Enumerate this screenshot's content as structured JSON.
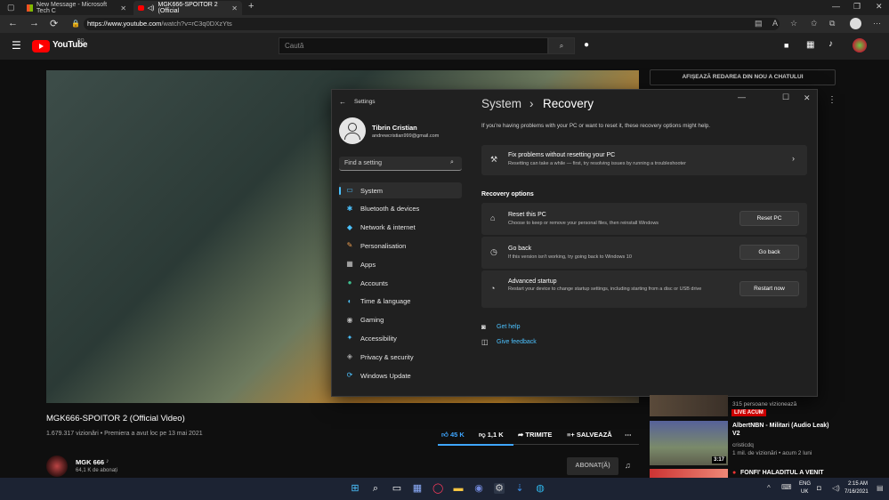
{
  "browser": {
    "tabs": [
      {
        "label": "New Message - Microsoft Tech C"
      },
      {
        "label": "MGK666-SPOITOR 2 (Official"
      }
    ],
    "url_host": "https://www.youtube.com",
    "url_path": "/watch?v=rC3q0DXzYts"
  },
  "youtube": {
    "logo_text": "YouTube",
    "region": "RO",
    "search_placeholder": "Caută",
    "chat_button": "AFIȘEAZĂ REDAREA DIN NOU A CHATULUI",
    "video": {
      "title": "MGK666-SPOITOR 2 (Official Video)",
      "meta": "1.679.317 vizionări • Premiera a avut loc pe 13 mai 2021",
      "likes": "45 K",
      "dislikes": "1,1 K",
      "share": "TRIMITE",
      "save": "SALVEAZĂ",
      "channel": "MGK 666",
      "channel_note": "♪",
      "subscribers": "64,1 K de abonați",
      "subscribe": "ABONAT(Ă)"
    },
    "recommendations": [
      {
        "sub1": "315 persoane vizionează",
        "live": "LIVE ACUM"
      },
      {
        "title": "AlbertNBN - Militari (Audio Leak) V2",
        "channel": "cristicdq",
        "meta": "1 mil. de vizionări • acum 2 luni",
        "duration": "3:17"
      },
      {
        "title": "FONFI' HALADITUL A VENIT"
      }
    ]
  },
  "settings": {
    "app_title": "Settings",
    "user_name": "Tibrin Cristian",
    "user_email": "andrewcristian999@gmail.com",
    "search_placeholder": "Find a setting",
    "nav": [
      {
        "label": "System",
        "icon": "monitor-icon",
        "glyph": "▭",
        "color": "#4cc2ff"
      },
      {
        "label": "Bluetooth & devices",
        "icon": "bluetooth-icon",
        "glyph": "✱",
        "color": "#4cc2ff"
      },
      {
        "label": "Network & internet",
        "icon": "wifi-icon",
        "glyph": "◆",
        "color": "#4cc2ff"
      },
      {
        "label": "Personalisation",
        "icon": "brush-icon",
        "glyph": "✎",
        "color": "#f0a050"
      },
      {
        "label": "Apps",
        "icon": "apps-icon",
        "glyph": "▦",
        "color": "#cccccc"
      },
      {
        "label": "Accounts",
        "icon": "person-icon",
        "glyph": "●",
        "color": "#3fbf8f"
      },
      {
        "label": "Time & language",
        "icon": "globe-icon",
        "glyph": "◐",
        "color": "#4cc2ff"
      },
      {
        "label": "Gaming",
        "icon": "gamepad-icon",
        "glyph": "◉",
        "color": "#bbbbbb"
      },
      {
        "label": "Accessibility",
        "icon": "accessibility-icon",
        "glyph": "✦",
        "color": "#4cc2ff"
      },
      {
        "label": "Privacy & security",
        "icon": "shield-icon",
        "glyph": "◈",
        "color": "#aaaaaa"
      },
      {
        "label": "Windows Update",
        "icon": "update-icon",
        "glyph": "⟳",
        "color": "#4cc2ff"
      }
    ],
    "breadcrumb_parent": "System",
    "breadcrumb_sep": "›",
    "breadcrumb_current": "Recovery",
    "intro": "If you're having problems with your PC or want to reset it, these recovery options might help.",
    "fix": {
      "title": "Fix problems without resetting your PC",
      "desc": "Resetting can take a while — first, try resolving issues by running a troubleshooter"
    },
    "options_heading": "Recovery options",
    "options": [
      {
        "title": "Reset this PC",
        "desc": "Choose to keep or remove your personal files, then reinstall Windows",
        "button": "Reset PC"
      },
      {
        "title": "Go back",
        "desc": "If this version isn't working, try going back to Windows 10",
        "button": "Go back"
      },
      {
        "title": "Advanced startup",
        "desc": "Restart your device to change startup settings, including starting from a disc or USB drive",
        "button": "Restart now"
      }
    ],
    "help": "Get help",
    "feedback": "Give feedback"
  },
  "taskbar": {
    "lang": "ENG",
    "region": "UK",
    "time": "2:15 AM",
    "date": "7/16/2021"
  }
}
